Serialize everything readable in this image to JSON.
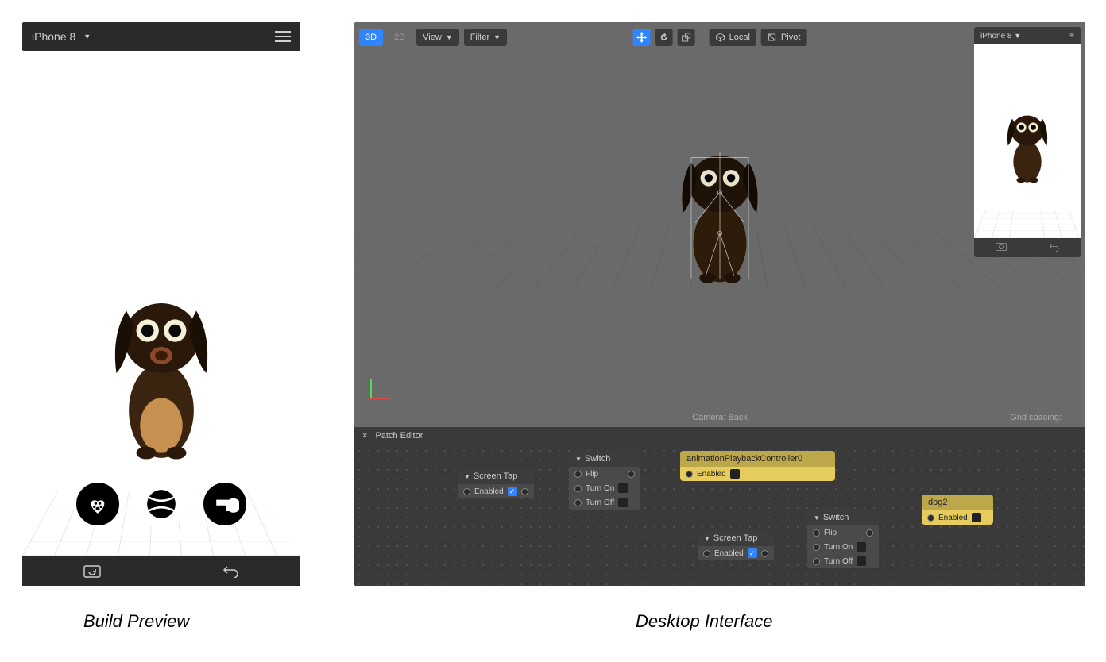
{
  "captions": {
    "build": "Build Preview",
    "desktop": "Desktop Interface"
  },
  "build_preview": {
    "device": "iPhone 8",
    "buttons": [
      "paw-heart",
      "tennis-ball",
      "whistle"
    ],
    "footer_icons": [
      "camera-flip",
      "undo"
    ]
  },
  "desktop": {
    "toolbar": {
      "mode3d": "3D",
      "mode2d": "2D",
      "view": "View",
      "filter": "Filter",
      "space": "Local",
      "pivot": "Pivot"
    },
    "mini_preview": {
      "device": "iPhone 8"
    },
    "viewport": {
      "camera_label": "Camera: Back",
      "grid_label": "Grid spacing:"
    },
    "patch_editor": {
      "title": "Patch Editor",
      "nodes": {
        "screen_tap1": {
          "title": "Screen Tap",
          "enabled": "Enabled",
          "checked": true
        },
        "switch1": {
          "title": "Switch",
          "flip": "Flip",
          "on": "Turn On",
          "off": "Turn Off"
        },
        "anim_ctrl": {
          "title": "animationPlaybackController0",
          "enabled": "Enabled"
        },
        "screen_tap2": {
          "title": "Screen Tap",
          "enabled": "Enabled",
          "checked": true
        },
        "switch2": {
          "title": "Switch",
          "flip": "Flip",
          "on": "Turn On",
          "off": "Turn Off"
        },
        "dog2": {
          "title": "dog2",
          "enabled": "Enabled"
        }
      }
    }
  }
}
